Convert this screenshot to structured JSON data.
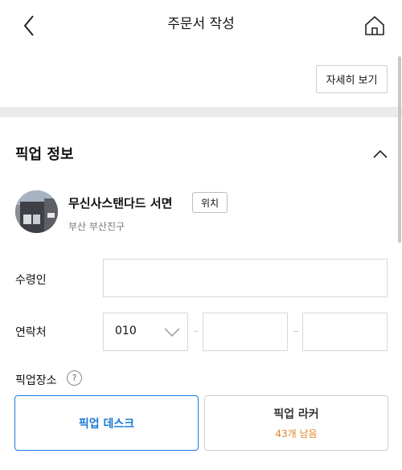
{
  "header": {
    "title": "주문서 작성",
    "back_icon": "chevron-left-icon",
    "home_icon": "home-icon"
  },
  "detail_button": "자세히 보기",
  "pickup": {
    "section_title": "픽업 정보",
    "collapse_icon": "chevron-up-icon",
    "store": {
      "name": "무신사스탠다드 서면",
      "location_button": "위치",
      "address": "부산 부산진구"
    },
    "recipient_label": "수령인",
    "recipient_value": "",
    "contact_label": "연락처",
    "phone_prefix": "010",
    "phone_middle": "",
    "phone_last": "",
    "place_label": "픽업장소",
    "help_glyph": "?",
    "options": [
      {
        "label": "픽업 데스크",
        "selected": true
      },
      {
        "label": "픽업 라커",
        "sub": "43개 남음",
        "selected": false
      }
    ]
  },
  "colors": {
    "accent": "#1a7ad6",
    "remaining": "#e0862a",
    "separator": "#ebebeb"
  }
}
